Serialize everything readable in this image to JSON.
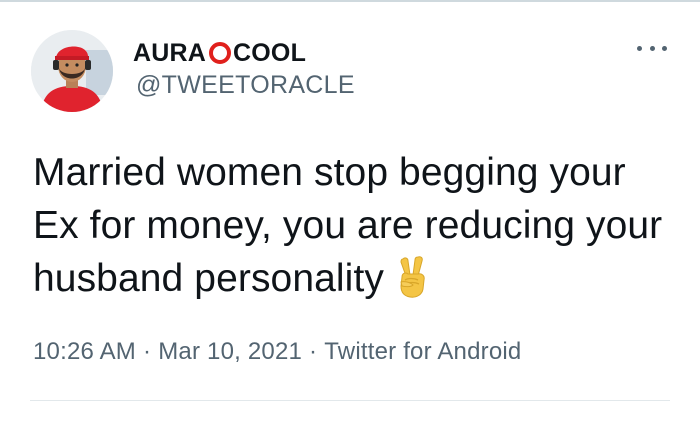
{
  "author": {
    "name_part1": "AURA",
    "name_part2": "COOL",
    "ring_color": "#e0201c",
    "handle": "@TWEETORACLE"
  },
  "tweet": {
    "text": "Married women stop begging your Ex for money, you are reducing your husband personality",
    "emoji": "victory-hand-emoji",
    "time": "10:26 AM",
    "date": "Mar 10, 2021",
    "source": "Twitter for Android",
    "separator": "·"
  },
  "colors": {
    "text": "#0f1419",
    "secondary": "#536471",
    "divider": "#e2e8eb"
  }
}
